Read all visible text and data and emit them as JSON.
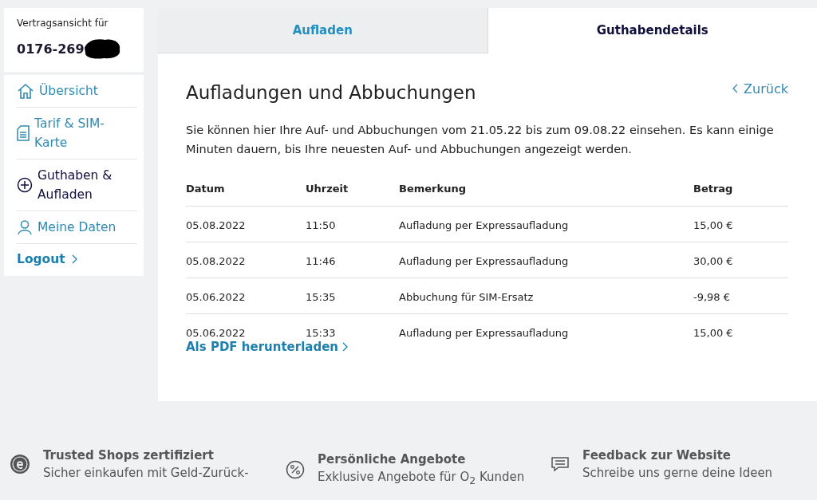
{
  "account": {
    "label": "Vertragsansicht für",
    "number": "0176-269"
  },
  "sidebar": {
    "items": [
      {
        "label": "Übersicht",
        "kind": "home",
        "selected": false
      },
      {
        "label": "Tarif & SIM-Karte",
        "kind": "document",
        "selected": false
      },
      {
        "label": "Guthaben & Aufladen",
        "kind": "plus",
        "selected": true
      },
      {
        "label": "Meine Daten",
        "kind": "person",
        "selected": false
      }
    ],
    "logout": "Logout"
  },
  "tabs": [
    {
      "label": "Aufladen",
      "selected": false
    },
    {
      "label": "Guthabendetails",
      "selected": true
    }
  ],
  "heading": "Aufladungen und Abbuchungen",
  "back_link": "Zurück",
  "description": "Sie können hier Ihre Auf- und Abbuchungen vom 21.05.22 bis zum 09.08.22 einsehen. Es kann einige Minuten dauern, bis Ihre neuesten Auf- und Abbuchungen angezeigt werden.",
  "table": {
    "columns": [
      "Datum",
      "Uhrzeit",
      "Bemerkung",
      "Betrag"
    ],
    "rows": [
      [
        "05.08.2022",
        "11:50",
        "Aufladung per Expressaufladung",
        "15,00 €"
      ],
      [
        "05.08.2022",
        "11:46",
        "Aufladung per Expressaufladung",
        "30,00 €"
      ],
      [
        "05.06.2022",
        "15:35",
        "Abbuchung für SIM-Ersatz",
        "-9,98 €"
      ],
      [
        "05.06.2022",
        "15:33",
        "Aufladung per Expressaufladung",
        "15,00 €"
      ]
    ]
  },
  "pdf_link": "Als PDF herunterladen",
  "footer": [
    {
      "kind": "seal",
      "title": "Trusted Shops zertifiziert",
      "text": "Sicher einkaufen mit Geld-Zurück-"
    },
    {
      "kind": "percent",
      "title": "Persönliche Angebote",
      "text": "Exklusive Angebote für O$_{2}$ Kunden"
    },
    {
      "kind": "chat",
      "title": "Feedback zur Website",
      "text": "Schreibe uns gerne deine Ideen"
    }
  ]
}
